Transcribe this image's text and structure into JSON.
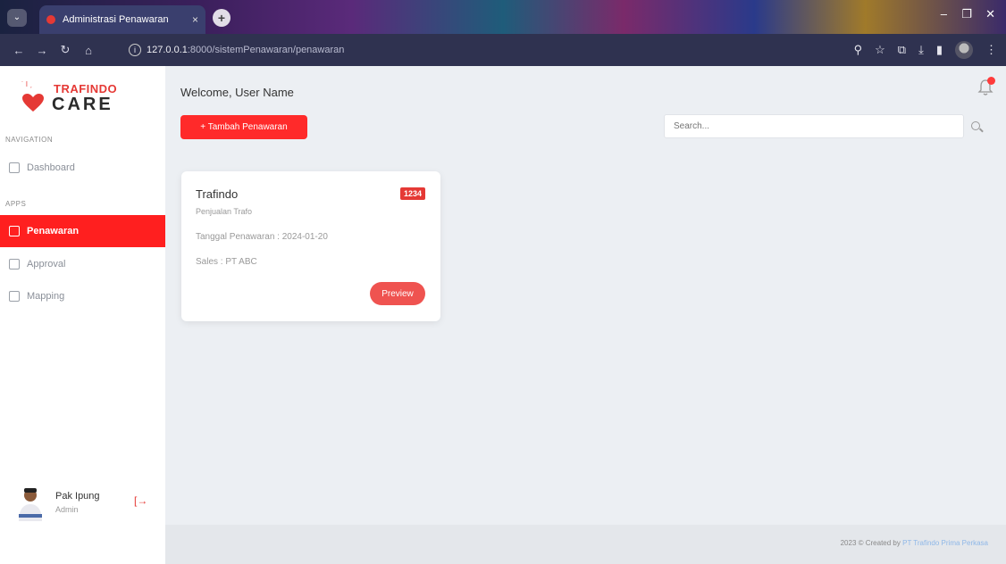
{
  "browser": {
    "tab_title": "Administrasi Penawaran",
    "url_host": "127.0.0.1",
    "url_rest": ":8000/sistemPenawaran/penawaran"
  },
  "sidebar": {
    "brand_top": "TRAFINDO",
    "brand_bottom": "CARE",
    "nav_label": "NAVIGATION",
    "apps_label": "APPS",
    "items": [
      {
        "label": "Dashboard",
        "active": false
      },
      {
        "label": "Penawaran",
        "active": true
      },
      {
        "label": "Approval",
        "active": false
      },
      {
        "label": "Mapping",
        "active": false
      }
    ],
    "user": {
      "name": "Pak Ipung",
      "role": "Admin"
    }
  },
  "header": {
    "welcome": "Welcome, User Name",
    "add_button": "+ Tambah Penawaran",
    "search_placeholder": "Search..."
  },
  "cards": [
    {
      "title": "Trafindo",
      "badge": "1234",
      "subtitle": "Penjualan Trafo",
      "date_line": "Tanggal Penawaran : 2024-01-20",
      "sales_line": "Sales : PT ABC",
      "button": "Preview"
    }
  ],
  "footer": {
    "prefix": "2023 © Created by",
    "company": "PT Trafindo Prima Perkasa"
  },
  "colors": {
    "accent": "#ff1f1f",
    "preview_button": "#ef5350"
  }
}
